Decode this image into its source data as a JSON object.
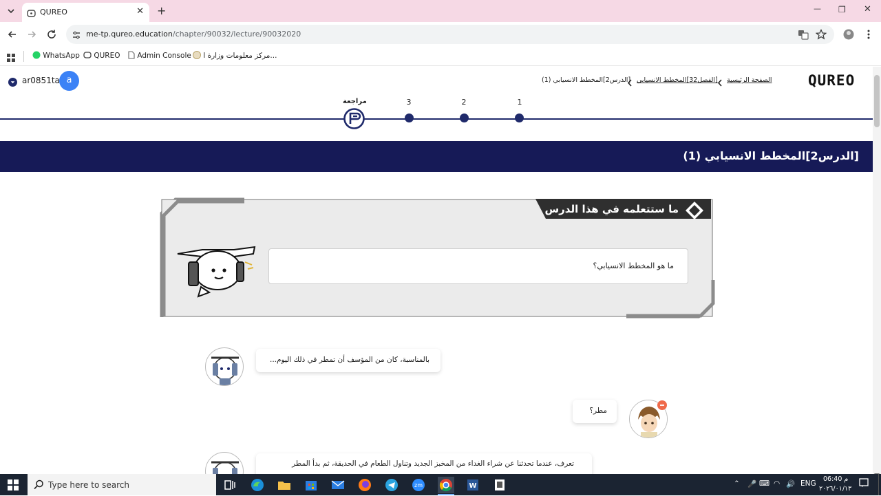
{
  "browser": {
    "tab_title": "QUREO",
    "tab_close": "✕",
    "new_tab": "+",
    "win_minimize": "—",
    "win_restore": "❐",
    "win_close": "✕",
    "url_host": "me-tp.qureo.education",
    "url_path": "/chapter/90032/lecture/90032020",
    "bookmarks": [
      "WhatsApp",
      "QUREO",
      "Admin Console",
      "مركز معلومات وزارة ا..."
    ]
  },
  "header": {
    "logo": "QUREO",
    "breadcrumb_home": "الصفحة الرئيسية",
    "breadcrumb_chapter": "[الفصل32]المخطط الانسيابي",
    "breadcrumb_lesson": "[الدرس2]المخطط الانسيابي (1)",
    "username": "ar0851ta",
    "avatar_letter": "a"
  },
  "steps": {
    "review_label": "مراجعة",
    "items": [
      "3",
      "2",
      "1"
    ]
  },
  "lesson": {
    "title": "[الدرس2]المخطط الانسيابي (1)",
    "objectives_heading": "ما ستتعلمه في هذا الدرس",
    "objective_question": "ما هو المخطط الانسيابي؟"
  },
  "chat": {
    "msg1": "بالمناسبة، كان من المؤسف أن تمطر في ذلك اليوم...",
    "msg2": "مطر؟",
    "msg3": "تعرف، عندما تحدثنا عن شراء الغداء من المخبز الجديد وتناول الطعام في الحديقة، ثم بدأ المطر"
  },
  "taskbar": {
    "search_placeholder": "Type here to search",
    "lang": "ENG",
    "time": "06:40 م",
    "date": "٢٠٢٦/٠١/١٣"
  },
  "colors": {
    "tab_bar": "#f6d9e5",
    "lesson_bar": "#161a57",
    "step_dot": "#1f2a6b",
    "avatar": "#3b82f6",
    "taskbar": "#1b2432"
  }
}
